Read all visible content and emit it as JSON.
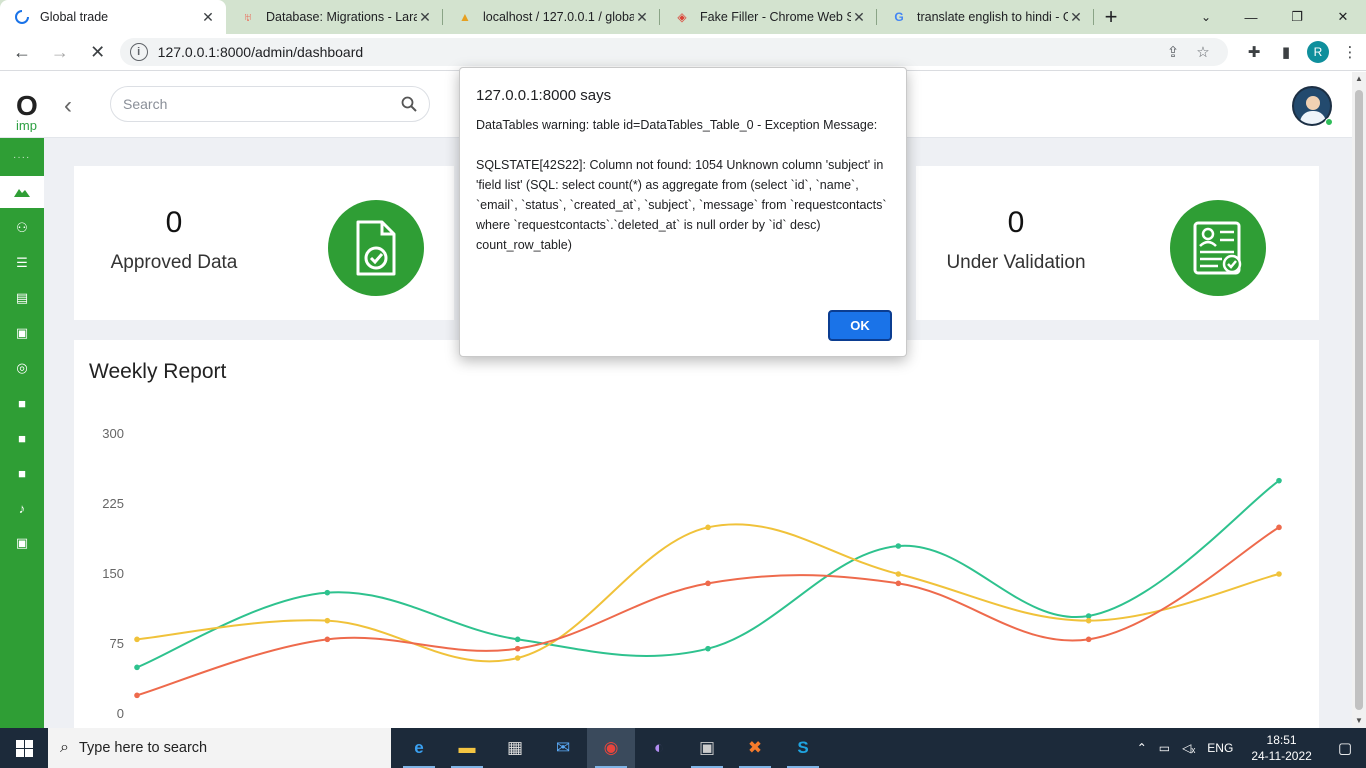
{
  "browser": {
    "tabs": [
      {
        "title": "Global trade",
        "icon": "loading-icon",
        "active": true
      },
      {
        "title": "Database: Migrations - Larave",
        "icon": "laravel-icon"
      },
      {
        "title": "localhost / 127.0.0.1 / globalt",
        "icon": "phpmyadmin-icon"
      },
      {
        "title": "Fake Filler - Chrome Web Sto",
        "icon": "chrome-web-store-icon"
      },
      {
        "title": "translate english to hindi - G",
        "icon": "google-icon"
      }
    ],
    "url": "127.0.0.1:8000/admin/dashboard",
    "profile_initial": "R"
  },
  "header": {
    "search_placeholder": "Search",
    "logo_letter": "O",
    "logo_sub": "imp"
  },
  "stats": [
    {
      "value": "0",
      "label": "Approved Data"
    },
    {
      "value": "0",
      "label": "Under Validation"
    }
  ],
  "chart_title": "Weekly Report",
  "chart_data": {
    "type": "line",
    "title": "Weekly Report",
    "ylim": [
      0,
      300
    ],
    "yticks": [
      "0",
      "75",
      "150",
      "225",
      "300"
    ],
    "x": [
      1,
      2,
      3,
      4,
      5,
      6,
      7
    ],
    "series": [
      {
        "color": "#2ec28e",
        "values": [
          50,
          130,
          80,
          70,
          180,
          105,
          250
        ]
      },
      {
        "color": "#f0c23a",
        "values": [
          80,
          100,
          60,
          200,
          150,
          100,
          150
        ]
      },
      {
        "color": "#ee6a4c",
        "values": [
          20,
          80,
          70,
          140,
          140,
          80,
          200
        ]
      }
    ]
  },
  "dialog": {
    "title": "127.0.0.1:8000 says",
    "message": "DataTables warning: table id=DataTables_Table_0 - Exception Message:\n\nSQLSTATE[42S22]: Column not found: 1054 Unknown column 'subject' in 'field list' (SQL: select count(*) as aggregate from (select `id`, `name`, `email`, `status`, `created_at`, `subject`, `message` from `requestcontacts` where `requestcontacts`.`deleted_at` is null order by `id` desc) count_row_table)",
    "ok_label": "OK"
  },
  "taskbar": {
    "search_placeholder": "Type here to search",
    "language": "ENG",
    "time": "18:51",
    "date": "24-11-2022"
  },
  "colors": {
    "accent_green": "#2f9e35",
    "dialog_button": "#1a73e8"
  }
}
